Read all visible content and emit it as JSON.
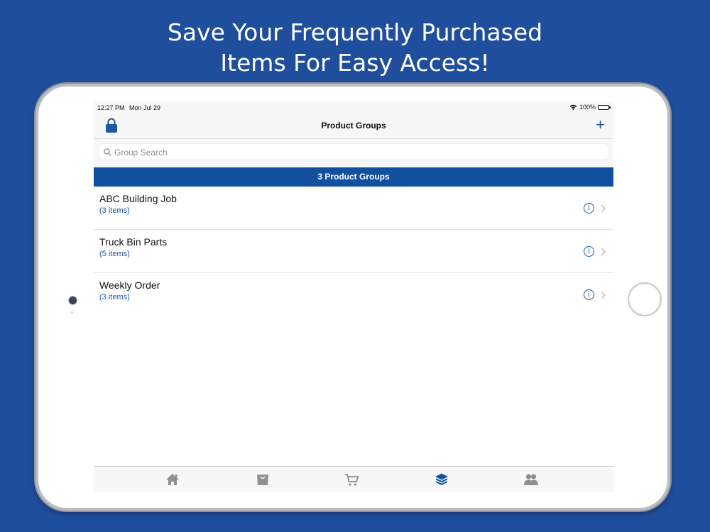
{
  "headline": {
    "line1": "Save Your Frequently Purchased",
    "line2": "Items For Easy Access!"
  },
  "status_bar": {
    "time": "12:27 PM",
    "date": "Mon Jul 29",
    "battery": "100%",
    "battery_level": 1.0
  },
  "nav": {
    "title": "Product Groups",
    "left_icon": "lock-icon",
    "right_icon": "plus-icon",
    "add_label": "+"
  },
  "search": {
    "placeholder": "Group Search",
    "value": ""
  },
  "section_header": "3 Product Groups",
  "groups": [
    {
      "name": "ABC Building Job",
      "count": "(3 items)"
    },
    {
      "name": "Truck Bin Parts",
      "count": "(5 items)"
    },
    {
      "name": "Weekly Order",
      "count": "(3 items)"
    }
  ],
  "info_glyph": "i",
  "tabs": [
    {
      "icon": "home-icon",
      "active": false
    },
    {
      "icon": "shopping-bag-icon",
      "active": false
    },
    {
      "icon": "cart-icon",
      "active": false
    },
    {
      "icon": "layers-icon",
      "active": true
    },
    {
      "icon": "users-icon",
      "active": false
    }
  ],
  "colors": {
    "background": "#1f4e9c",
    "accent": "#1f57a4",
    "section_header": "#10509f",
    "tab_inactive": "#8e8e93"
  }
}
